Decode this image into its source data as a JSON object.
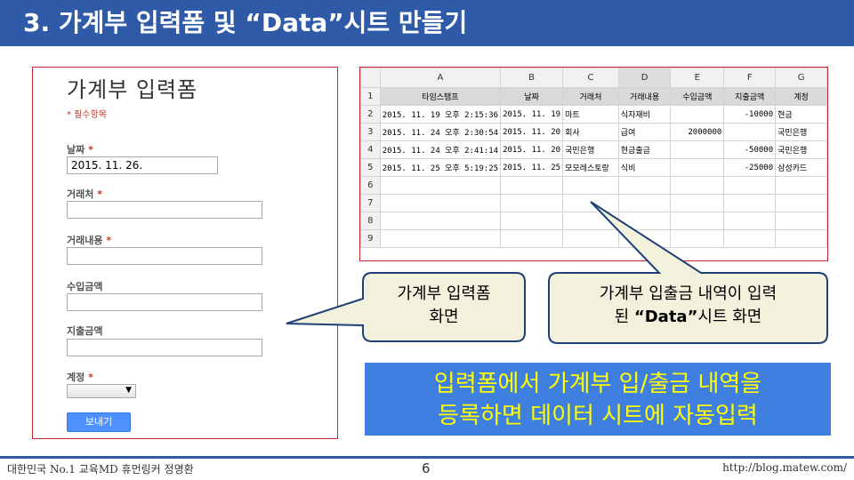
{
  "slide": {
    "title": "3. 가계부 입력폼 및 “Data”시트 만들기"
  },
  "form": {
    "title": "가계부 입력폼",
    "required_note": "* 필수항목",
    "fields": [
      {
        "label": "날짜",
        "required": "*",
        "value": "2015. 11. 26."
      },
      {
        "label": "거래처",
        "required": "*",
        "value": ""
      },
      {
        "label": "거래내용",
        "required": "*",
        "value": ""
      },
      {
        "label": "수입금액",
        "required": "",
        "value": ""
      },
      {
        "label": "지출금액",
        "required": "",
        "value": ""
      },
      {
        "label": "계정",
        "required": "*",
        "value": ""
      }
    ],
    "submit_label": "보내기"
  },
  "sheet": {
    "columns": [
      "A",
      "B",
      "C",
      "D",
      "E",
      "F",
      "G"
    ],
    "rows": [
      [
        "1",
        "타임스탬프",
        "날짜",
        "거래처",
        "거래내용",
        "수입금액",
        "지출금액",
        "계정"
      ],
      [
        "2",
        "2015. 11. 19 오후 2:15:36",
        "2015. 11. 19",
        "마트",
        "식자재비",
        "",
        "-10000",
        "현금"
      ],
      [
        "3",
        "2015. 11. 24 오후 2:30:54",
        "2015. 11. 20",
        "회사",
        "급여",
        "2000000",
        "",
        "국민은행"
      ],
      [
        "4",
        "2015. 11. 24 오후 2:41:14",
        "2015. 11. 20",
        "국민은행",
        "현금출금",
        "",
        "-50000",
        "국민은행"
      ],
      [
        "5",
        "2015. 11. 25 오후 5:19:25",
        "2015. 11. 25",
        "모모레스토랑",
        "식비",
        "",
        "-25000",
        "삼성카드"
      ],
      [
        "6",
        "",
        "",
        "",
        "",
        "",
        "",
        ""
      ],
      [
        "7",
        "",
        "",
        "",
        "",
        "",
        "",
        ""
      ],
      [
        "8",
        "",
        "",
        "",
        "",
        "",
        "",
        ""
      ],
      [
        "9",
        "",
        "",
        "",
        "",
        "",
        "",
        ""
      ]
    ]
  },
  "callouts": {
    "form_line1": "가계부 입력폼",
    "form_line2": "화면",
    "sheet_line1": "가계부 입출금 내역이 입력",
    "sheet_line2_pre": "된 ",
    "sheet_line2_bold": "“Data”",
    "sheet_line2_post": "시트 화면"
  },
  "highlight": {
    "line1": "입력폼에서 가계부 입/출금 내역을",
    "line2": "등록하면 데이터 시트에 자동입력"
  },
  "footer": {
    "left": "대한민국 No.1 교육MD 휴먼링커 정명환",
    "page": "6",
    "right": "http://blog.matew.com/"
  },
  "colors": {
    "title_bar": "#2f5aa8",
    "panel_border": "#c0262d",
    "callout_fill": "#f2f1dc",
    "callout_stroke": "#1f3f77",
    "highlight_fill": "#3f7fe0",
    "highlight_text": "#ffff00"
  }
}
